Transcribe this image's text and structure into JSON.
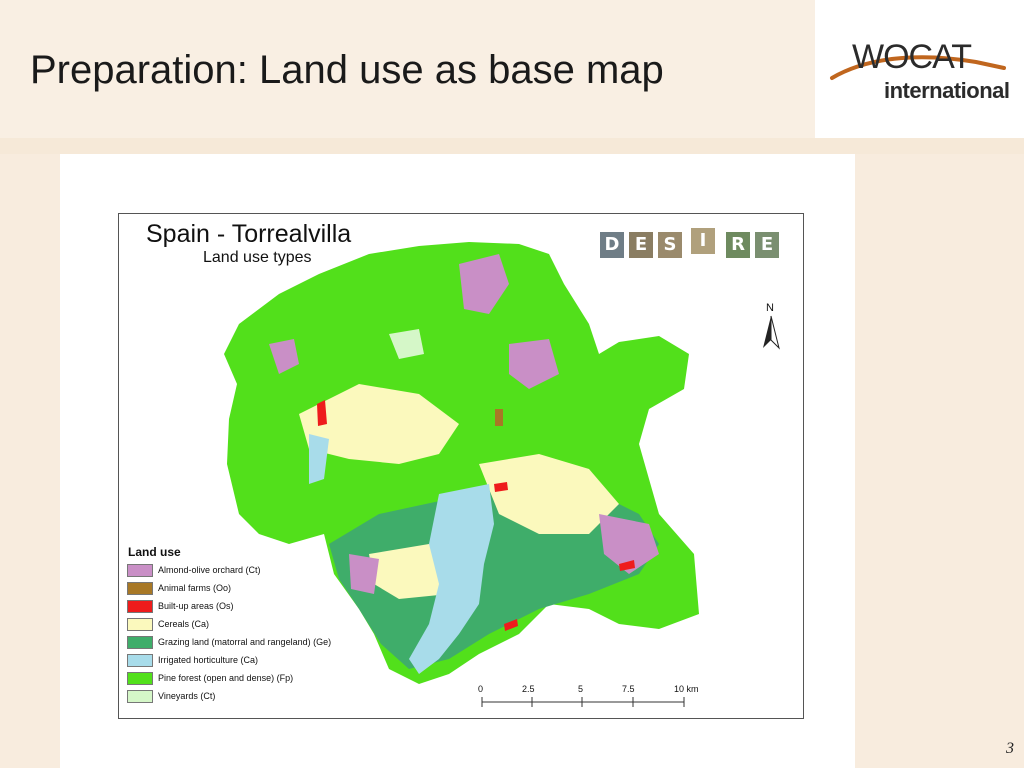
{
  "slide": {
    "title": "Preparation: Land use as base map",
    "page_number": "3"
  },
  "logo": {
    "word": "WOCAT",
    "sub": "international",
    "accent_color": "#c0661e"
  },
  "map": {
    "title": "Spain - Torrealvilla",
    "subtitle": "Land use types",
    "badge_letters": [
      "D",
      "E",
      "S",
      "I",
      "R",
      "E"
    ],
    "north_label": "N",
    "legend": {
      "title": "Land use",
      "items": [
        {
          "label": "Almond-olive orchard (Ct)",
          "color": "#c98fc6"
        },
        {
          "label": "Animal farms (Oo)",
          "color": "#a87826"
        },
        {
          "label": "Built-up areas (Os)",
          "color": "#ee1c1c"
        },
        {
          "label": "Cereals (Ca)",
          "color": "#fbf9bd"
        },
        {
          "label": "Grazing land (matorral and rangeland) (Ge)",
          "color": "#3fad6a"
        },
        {
          "label": "Irrigated horticulture (Ca)",
          "color": "#a8dcea"
        },
        {
          "label": "Pine forest (open and dense) (Fp)",
          "color": "#52e01b"
        },
        {
          "label": "Vineyards (Ct)",
          "color": "#d5f7c8"
        }
      ]
    },
    "scale": {
      "labels": [
        "0",
        "2.5",
        "5",
        "7.5",
        "10 km"
      ]
    }
  }
}
